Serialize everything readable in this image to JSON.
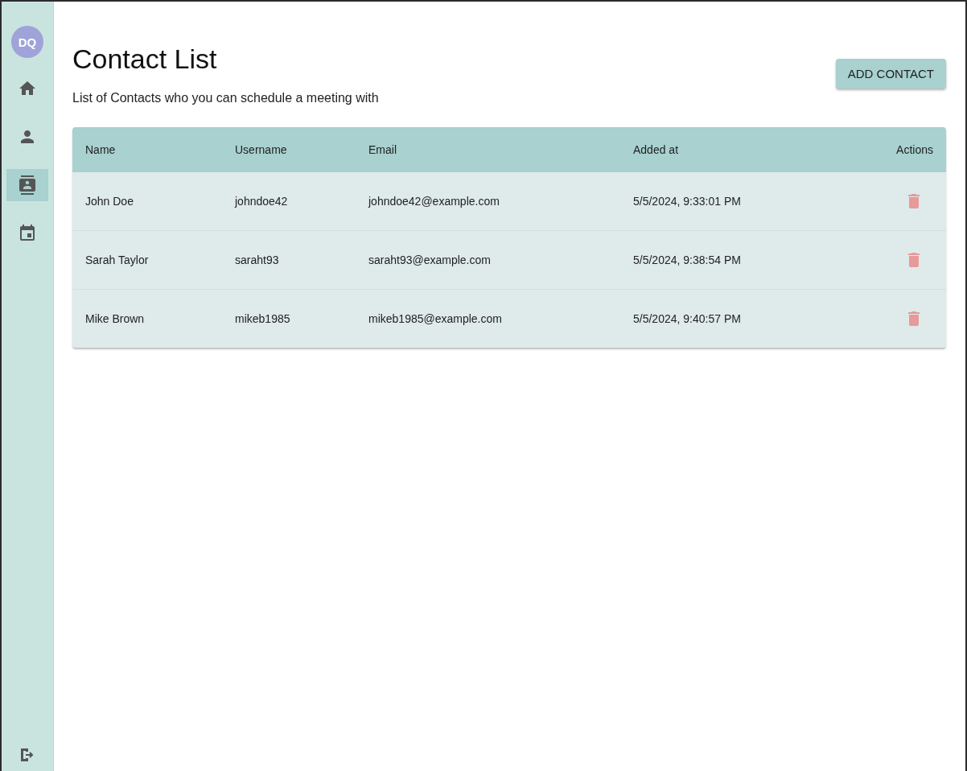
{
  "sidebar": {
    "avatar": "DQ",
    "items": [
      {
        "selected": false
      },
      {
        "selected": false
      },
      {
        "selected": true
      },
      {
        "selected": false
      }
    ]
  },
  "header": {
    "title": "Contact List",
    "subtitle": "List of Contacts who you can schedule a meeting with",
    "button": "ADD CONTACT"
  },
  "table": {
    "columns": [
      "Name",
      "Username",
      "Email",
      "Added at",
      "Actions"
    ],
    "rows": [
      {
        "name": "John Doe",
        "username": "johndoe42",
        "email": "johndoe42@example.com",
        "added_at": "5/5/2024, 9:33:01 PM"
      },
      {
        "name": "Sarah Taylor",
        "username": "saraht93",
        "email": "saraht93@example.com",
        "added_at": "5/5/2024, 9:38:54 PM"
      },
      {
        "name": "Mike Brown",
        "username": "mikeb1985",
        "email": "mikeb1985@example.com",
        "added_at": "5/5/2024, 9:40:57 PM"
      }
    ]
  }
}
